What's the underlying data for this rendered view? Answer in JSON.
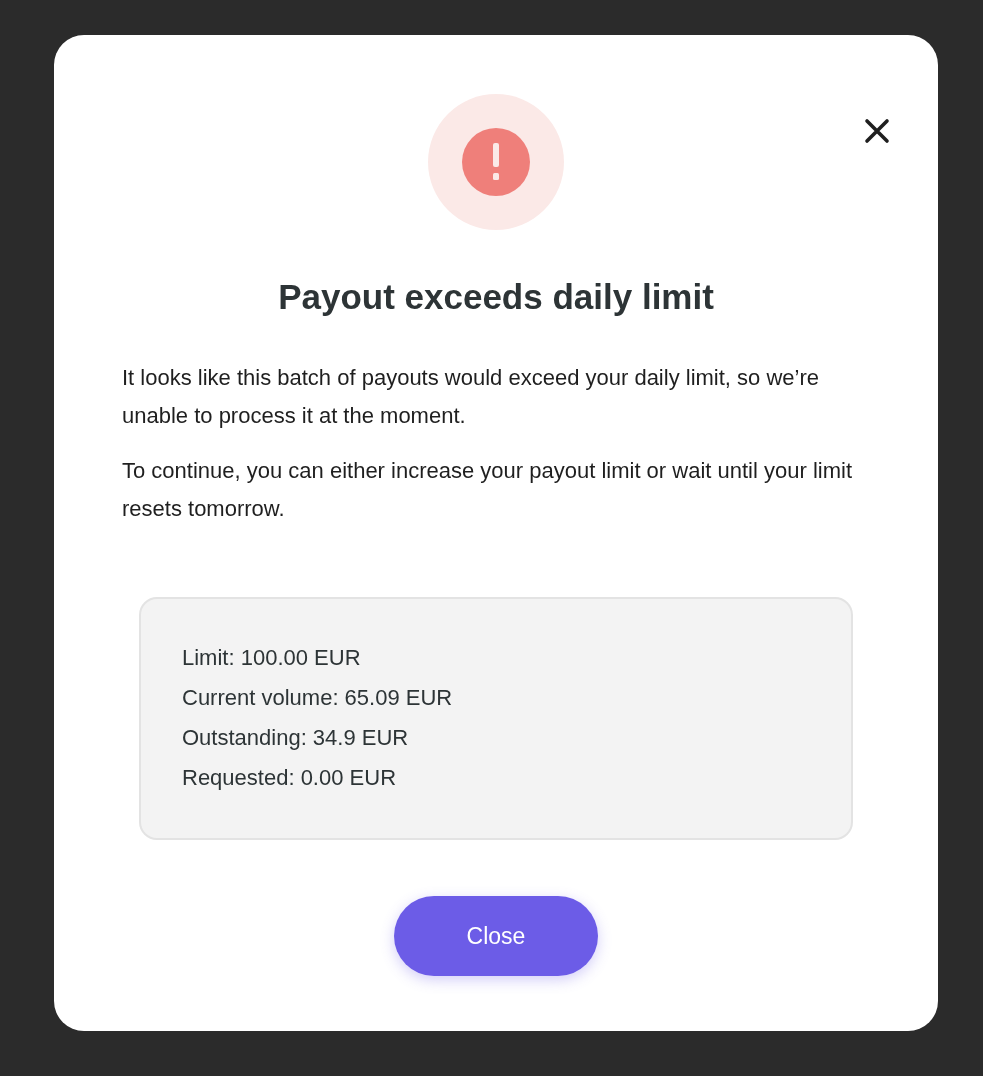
{
  "dialog": {
    "title": "Payout exceeds daily limit",
    "paragraphs": [
      "It looks like this batch of payouts would exceed your daily limit, so we’re unable to process it at the moment.",
      "To continue, you can either increase your payout limit or wait until your limit resets tomorrow."
    ],
    "details": [
      "Limit: 100.00 EUR",
      "Current volume: 65.09 EUR",
      "Outstanding: 34.9 EUR",
      "Requested: 0.00 EUR"
    ],
    "button": "Close"
  }
}
